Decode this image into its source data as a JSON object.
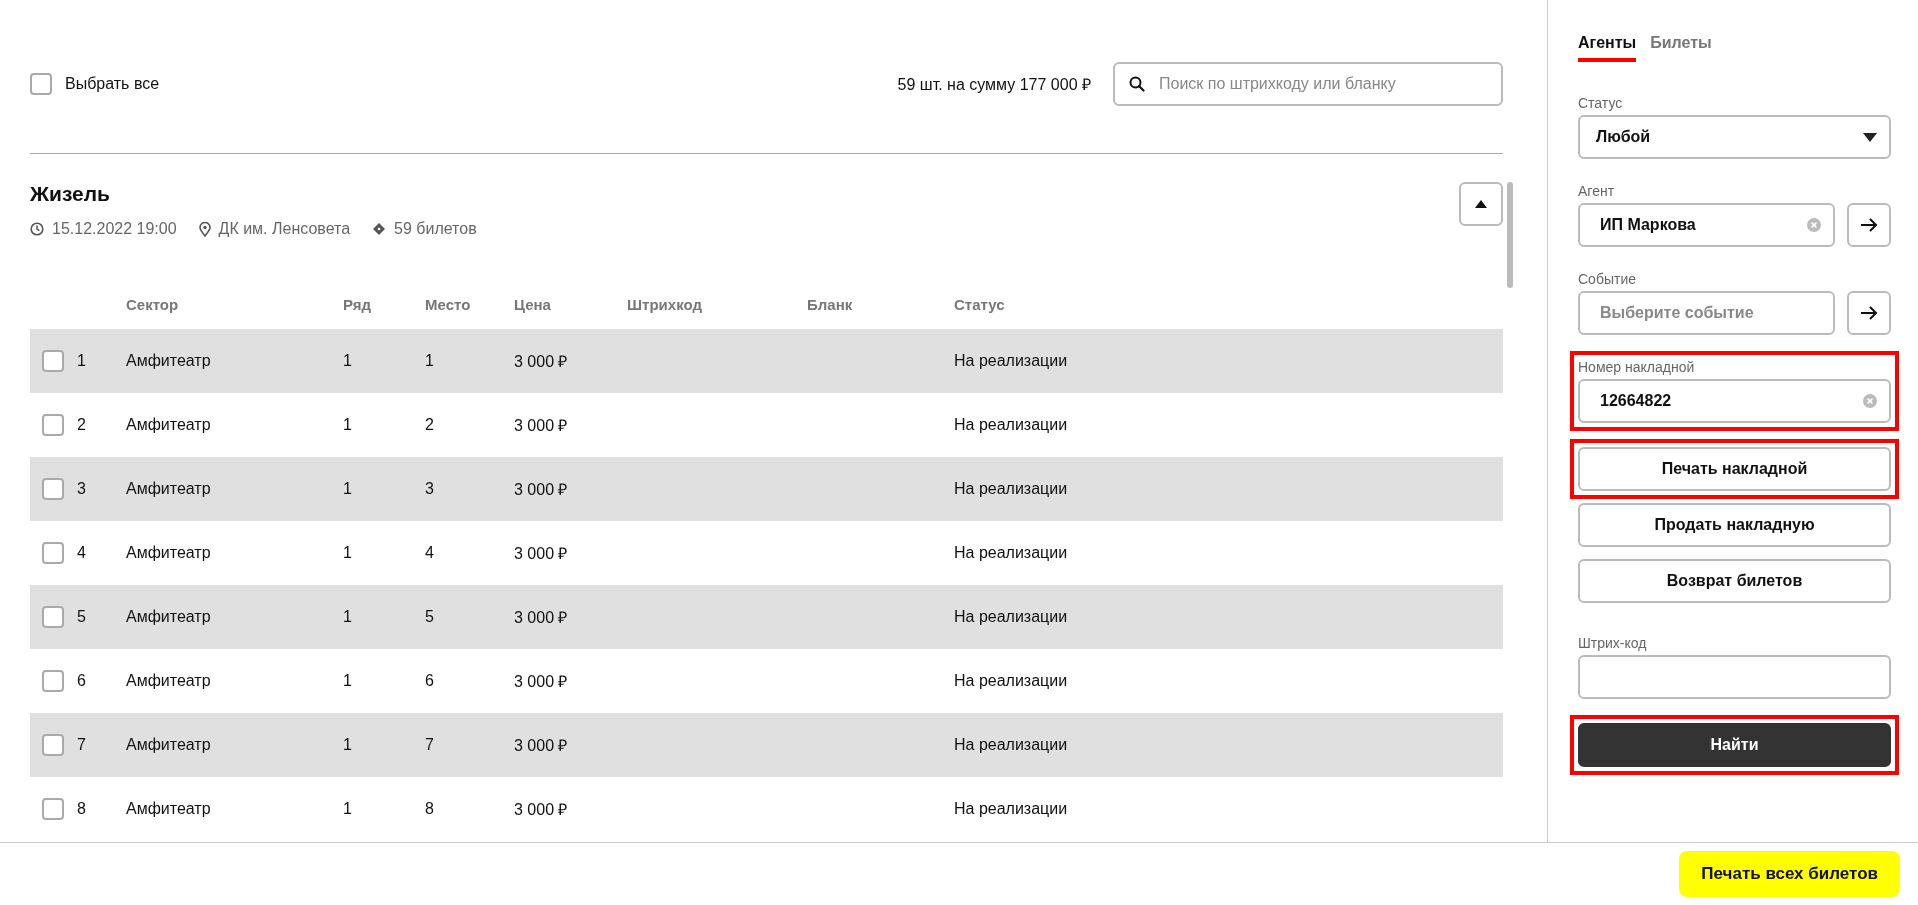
{
  "toolbar": {
    "select_all": {
      "label": "Выбрать все",
      "checked": false
    },
    "summary": "59 шт. на сумму 177 000 ₽",
    "search": {
      "placeholder": "Поиск по штрихкоду или бланку"
    }
  },
  "event": {
    "title": "Жизель",
    "datetime": "15.12.2022 19:00",
    "venue": "ДК им. Ленсовета",
    "tickets": "59 билетов",
    "expanded": true
  },
  "table": {
    "columns": [
      "Сектор",
      "Ряд",
      "Место",
      "Цена",
      "Штрихкод",
      "Бланк",
      "Статус"
    ],
    "rows": [
      {
        "number": "1",
        "sector": "Амфитеатр",
        "row": "1",
        "seat": "1",
        "price": "3 000 ₽",
        "status": "На реализации",
        "checked": false
      },
      {
        "number": "2",
        "sector": "Амфитеатр",
        "row": "1",
        "seat": "2",
        "price": "3 000 ₽",
        "status": "На реализации",
        "checked": false
      },
      {
        "number": "3",
        "sector": "Амфитеатр",
        "row": "1",
        "seat": "3",
        "price": "3 000 ₽",
        "status": "На реализации",
        "checked": false
      },
      {
        "number": "4",
        "sector": "Амфитеатр",
        "row": "1",
        "seat": "4",
        "price": "3 000 ₽",
        "status": "На реализации",
        "checked": false
      },
      {
        "number": "5",
        "sector": "Амфитеатр",
        "row": "1",
        "seat": "5",
        "price": "3 000 ₽",
        "status": "На реализации",
        "checked": false
      },
      {
        "number": "6",
        "sector": "Амфитеатр",
        "row": "1",
        "seat": "6",
        "price": "3 000 ₽",
        "status": "На реализации",
        "checked": false
      },
      {
        "number": "7",
        "sector": "Амфитеатр",
        "row": "1",
        "seat": "7",
        "price": "3 000 ₽",
        "status": "На реализации",
        "checked": false
      },
      {
        "number": "8",
        "sector": "Амфитеатр",
        "row": "1",
        "seat": "8",
        "price": "3 000 ₽",
        "status": "На реализации",
        "checked": false
      }
    ]
  },
  "sidebar": {
    "tabs": [
      {
        "label": "Агенты",
        "selected": true
      },
      {
        "label": "Билеты",
        "selected": false
      }
    ],
    "items": [
      {
        "kind": "select",
        "label": "Статус",
        "value": "Любой",
        "highlighted": false
      },
      {
        "kind": "field",
        "label": "Агент",
        "value": "ИП Маркова",
        "clearable": true,
        "go_button": true,
        "highlighted": false
      },
      {
        "kind": "field",
        "label": "Событие",
        "placeholder": "Выберите событие",
        "clearable": false,
        "go_button": true,
        "highlighted": false
      },
      {
        "kind": "field",
        "label": "Номер накладной",
        "value": "12664822",
        "clearable": true,
        "go_button": false,
        "highlighted": true
      },
      {
        "kind": "button",
        "label": "Печать накладной",
        "highlighted": true
      },
      {
        "kind": "button",
        "label": "Продать накладную",
        "highlighted": false
      },
      {
        "kind": "button",
        "label": "Возврат билетов",
        "highlighted": false
      },
      {
        "kind": "field",
        "label": "Штрих-код",
        "clearable": false,
        "go_button": false,
        "highlighted": false
      },
      {
        "kind": "primary",
        "label": "Найти",
        "highlighted": true
      }
    ]
  },
  "footer": {
    "button": "Печать всех билетов"
  }
}
